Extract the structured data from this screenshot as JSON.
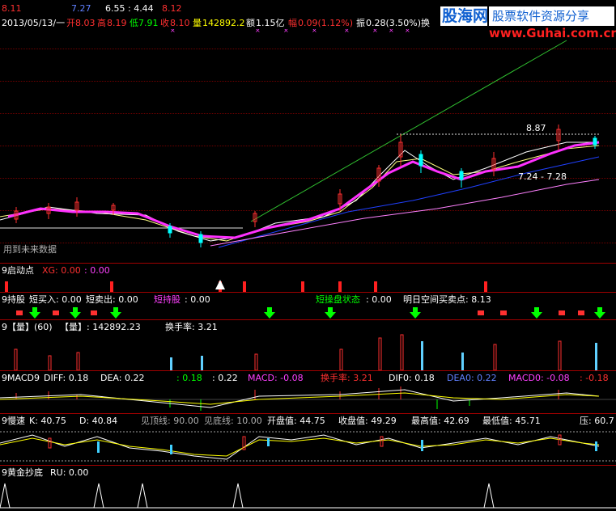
{
  "header": {
    "line0_a": "8.11",
    "line0_b": "7.27",
    "line0_c": "6.55 : 4.44",
    "line0_d": "8.12",
    "date": "2013/05/13/一",
    "open_label": "开",
    "open": "8.03",
    "high_label": "高",
    "high": "8.19",
    "low_label": "低",
    "low": "7.91",
    "close_label": "收",
    "close": "8.10",
    "vol_label": "量",
    "vol": "142892.2",
    "amt_label": "额",
    "amt": "1.15亿",
    "chg_label": "幅",
    "chg": "0.09(1.12%)",
    "amp_label": "振",
    "amp": "0.28(3.50%)",
    "turn_label": "换"
  },
  "logo": {
    "title": "股海网",
    "slogan": "股票软件资源分享",
    "url": "www.Guhai.com.cn"
  },
  "main_chart": {
    "watermark": "用到未来数据",
    "price_high": "8.87",
    "price_range": "7.24 - 7.28"
  },
  "panels": {
    "qidong": {
      "title": "9启动点",
      "xg_label": "XG: 0.00",
      "v2": ": 0.00"
    },
    "chigu": {
      "title": "9持股",
      "buy": "短买入: 0.00",
      "sell": "短卖出: 0.00",
      "hold": "短持股",
      "hold_val": ": 0.00",
      "state": "短操盘状态",
      "state_val": ": 0.00",
      "tomorrow": "明日空间买卖点: 8.13"
    },
    "volume": {
      "title": "9【量】(60)",
      "vol_label": "【量】: 142892.23",
      "turn": "换手率: 3.21"
    },
    "macd": {
      "title": "9MACD9",
      "diff": "DIFF: 0.18",
      "dea": "DEA: 0.22",
      "v1": ": 0.18",
      "v2": ": 0.22",
      "macd": "MACD: -0.08",
      "turn": "换手率: 3.21",
      "dif0": "DIF0: 0.18",
      "dea0": "DEA0: 0.22",
      "macd0": "MACD0: -0.08",
      "tail": ": -0.18"
    },
    "kd": {
      "title": "9慢速",
      "k": "K: 40.75",
      "d": "D: 40.84",
      "top": "见顶线: 90.00",
      "bottom": "见底线: 10.00",
      "open": "开盘值: 44.75",
      "close": "收盘值: 49.29",
      "highv": "最高值: 42.69",
      "lowv": "最低值: 45.71",
      "press": "压: 60.7"
    },
    "gold": {
      "title": "9黄金抄底",
      "ru": "RU: 0.00"
    }
  }
}
